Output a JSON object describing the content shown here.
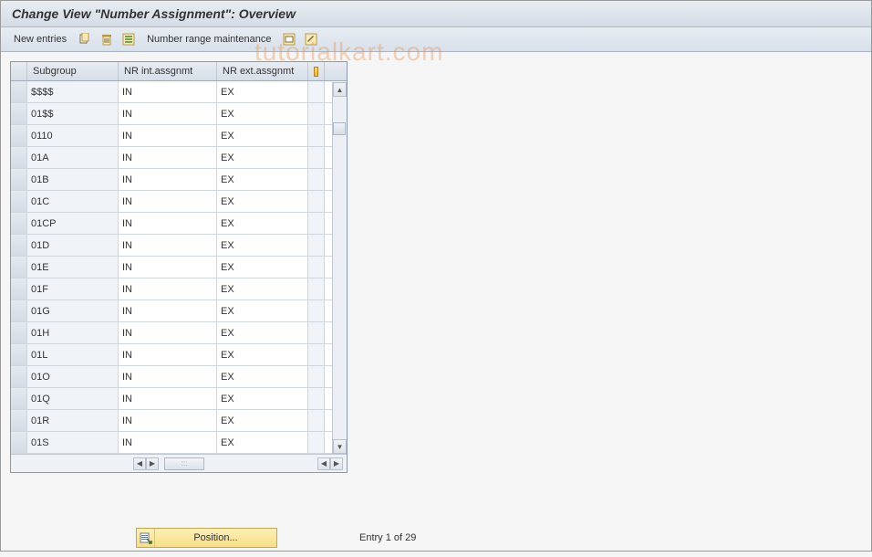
{
  "header": {
    "title": "Change View \"Number Assignment\": Overview"
  },
  "toolbar": {
    "new_entries_label": "New entries",
    "number_range_label": "Number range maintenance"
  },
  "table": {
    "headers": {
      "subgroup": "Subgroup",
      "int": "NR int.assgnmt",
      "ext": "NR ext.assgnmt"
    },
    "rows": [
      {
        "subgroup": "$$$$",
        "int": "IN",
        "ext": "EX"
      },
      {
        "subgroup": "01$$",
        "int": "IN",
        "ext": "EX"
      },
      {
        "subgroup": "0110",
        "int": "IN",
        "ext": "EX"
      },
      {
        "subgroup": "01A",
        "int": "IN",
        "ext": "EX"
      },
      {
        "subgroup": "01B",
        "int": "IN",
        "ext": "EX"
      },
      {
        "subgroup": "01C",
        "int": "IN",
        "ext": "EX"
      },
      {
        "subgroup": "01CP",
        "int": "IN",
        "ext": "EX"
      },
      {
        "subgroup": "01D",
        "int": "IN",
        "ext": "EX"
      },
      {
        "subgroup": "01E",
        "int": "IN",
        "ext": "EX"
      },
      {
        "subgroup": "01F",
        "int": "IN",
        "ext": "EX"
      },
      {
        "subgroup": "01G",
        "int": "IN",
        "ext": "EX"
      },
      {
        "subgroup": "01H",
        "int": "IN",
        "ext": "EX"
      },
      {
        "subgroup": "01L",
        "int": "IN",
        "ext": "EX"
      },
      {
        "subgroup": "01O",
        "int": "IN",
        "ext": "EX"
      },
      {
        "subgroup": "01Q",
        "int": "IN",
        "ext": "EX"
      },
      {
        "subgroup": "01R",
        "int": "IN",
        "ext": "EX"
      },
      {
        "subgroup": "01S",
        "int": "IN",
        "ext": "EX"
      }
    ]
  },
  "footer": {
    "position_label": "Position...",
    "entry_text": "Entry 1 of 29"
  },
  "watermark": "tutorialkart.com"
}
